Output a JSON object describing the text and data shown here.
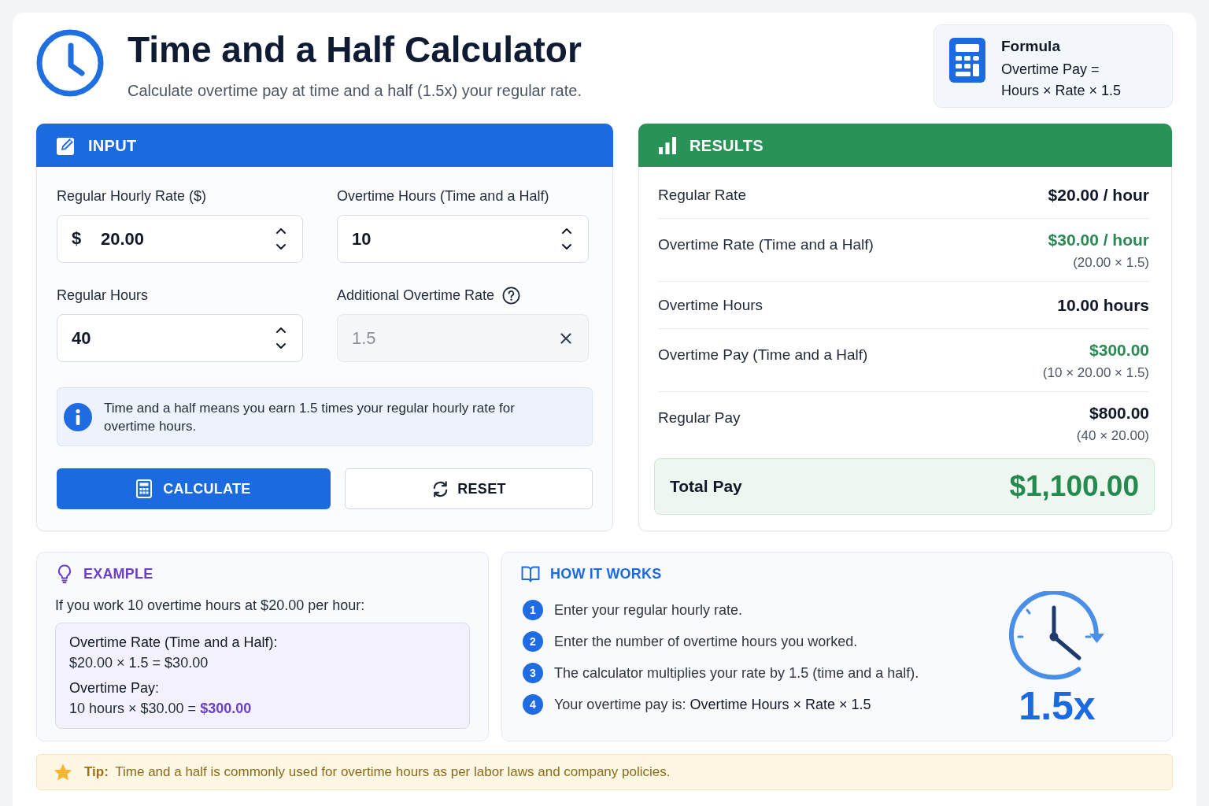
{
  "header": {
    "title": "Time and a Half Calculator",
    "subtitle": "Calculate overtime pay at time and a half (1.5x) your regular rate."
  },
  "formula_card": {
    "title": "Formula",
    "lines": [
      "Overtime Pay =",
      "Hours × Rate × 1.5"
    ]
  },
  "input_panel": {
    "title": "INPUT",
    "fields": [
      {
        "label": "Regular Hourly Rate ($)",
        "prefix": "$",
        "value": "20.00",
        "kind": "spinner",
        "help": false,
        "disabled": false
      },
      {
        "label": "Overtime Hours (Time and a Half)",
        "value": "10",
        "kind": "spinner",
        "help": false,
        "disabled": false
      },
      {
        "label": "Regular Hours",
        "value": "40",
        "kind": "spinner",
        "help": false,
        "disabled": false
      },
      {
        "label": "Additional Overtime Rate",
        "value": "1.5",
        "kind": "clearable",
        "help": true,
        "disabled": true
      }
    ],
    "info": "Time and a half means you earn 1.5 times your regular hourly rate for overtime hours.",
    "buttons": [
      {
        "label": "CALCULATE",
        "kind": "calculate"
      },
      {
        "label": "RESET",
        "kind": "reset"
      }
    ]
  },
  "results_panel": {
    "title": "RESULTS",
    "rows": [
      {
        "label": "Regular Rate",
        "value": "$20.00 / hour",
        "highlighted": false
      },
      {
        "label": "Overtime Rate (Time and a Half)",
        "value": "$30.00 / hour",
        "note": "(20.00 × 1.5)",
        "highlighted": true
      },
      {
        "label": "Overtime Hours",
        "value": "10.00 hours",
        "highlighted": false
      },
      {
        "label": "Overtime Pay (Time and a Half)",
        "value": "$300.00",
        "note": "(10 × 20.00 × 1.5)",
        "highlighted": true
      },
      {
        "label": "Regular Pay",
        "value": "$800.00",
        "note": "(40 × 20.00)",
        "highlighted": false
      }
    ],
    "total": {
      "label": "Total Pay",
      "value": "$1,100.00"
    }
  },
  "example": {
    "title": "EXAMPLE",
    "intro": "If you work 10 overtime hours at $20.00 per hour:",
    "blocks": [
      {
        "heading": "Overtime Rate (Time and a Half):",
        "formula": "$20.00 × 1.5 = $30.00"
      },
      {
        "heading": "Overtime Pay:",
        "formula": "10 hours × $30.00 = **$300.00**"
      }
    ]
  },
  "how_it_works": {
    "title": "HOW IT WORKS",
    "steps": [
      {
        "number": "1",
        "text": "Enter your regular hourly rate."
      },
      {
        "number": "2",
        "text": "Enter the number of overtime hours you worked."
      },
      {
        "number": "3",
        "text": "The calculator multiplies your rate by 1.5 (time and a half)."
      },
      {
        "number": "4",
        "text": "Your overtime pay is: **Overtime Hours × Rate × 1.5**"
      }
    ],
    "multiplier": "1.5x"
  },
  "tip": "**Tip:** Time and a half is commonly used for overtime hours as per labor laws and company policies."
}
